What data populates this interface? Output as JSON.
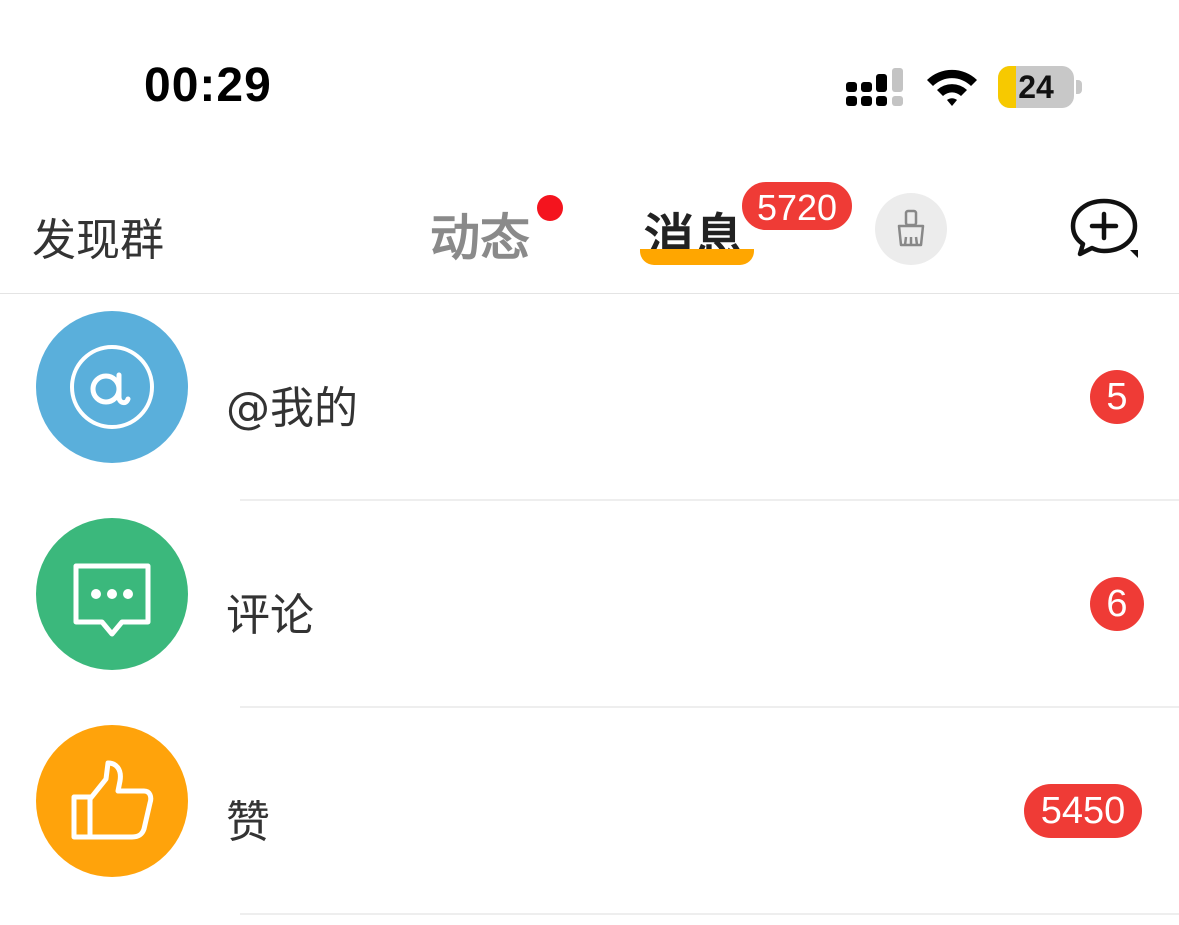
{
  "status_bar": {
    "time": "00:29",
    "battery_level": "24",
    "battery_color": "#f7c900"
  },
  "nav": {
    "left_label": "发现群",
    "tabs": [
      {
        "label": "动态",
        "has_dot": true,
        "active": false
      },
      {
        "label": "消息",
        "badge": "5720",
        "active": true
      }
    ],
    "icons": [
      "broom-icon",
      "compose-message-icon"
    ],
    "accent_color": "#ffa600"
  },
  "list": {
    "items": [
      {
        "label": "@我的",
        "count": "5",
        "icon": "at-sign-icon",
        "color": "#5aafdb"
      },
      {
        "label": "评论",
        "count": "6",
        "icon": "comment-icon",
        "color": "#3bb87c"
      },
      {
        "label": "赞",
        "count": "5450",
        "icon": "thumbs-up-icon",
        "color": "#ffa30b"
      }
    ]
  },
  "badge_color": "#ef3b36"
}
